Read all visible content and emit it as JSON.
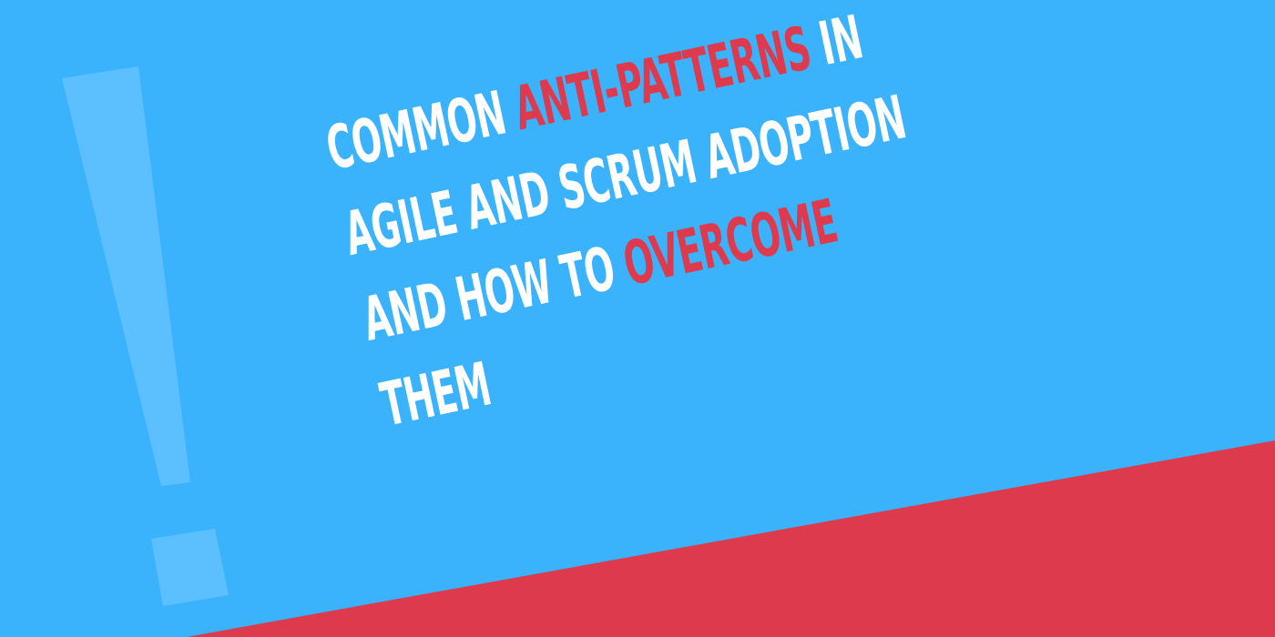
{
  "colors": {
    "background": "#3bb2fc",
    "accent": "#de3a4e",
    "exclamation": "#5cc0ff",
    "text": "#ffffff"
  },
  "decoration": {
    "icon": "exclamation-mark-icon"
  },
  "headline": {
    "line1": {
      "a": "COMMON ",
      "b": "ANTI-PATTERNS",
      "c": " IN"
    },
    "line2": "AGILE AND SCRUM ADOPTION",
    "line3": {
      "a": "AND HOW TO ",
      "b": "OVERCOME"
    },
    "line4": "THEM"
  }
}
